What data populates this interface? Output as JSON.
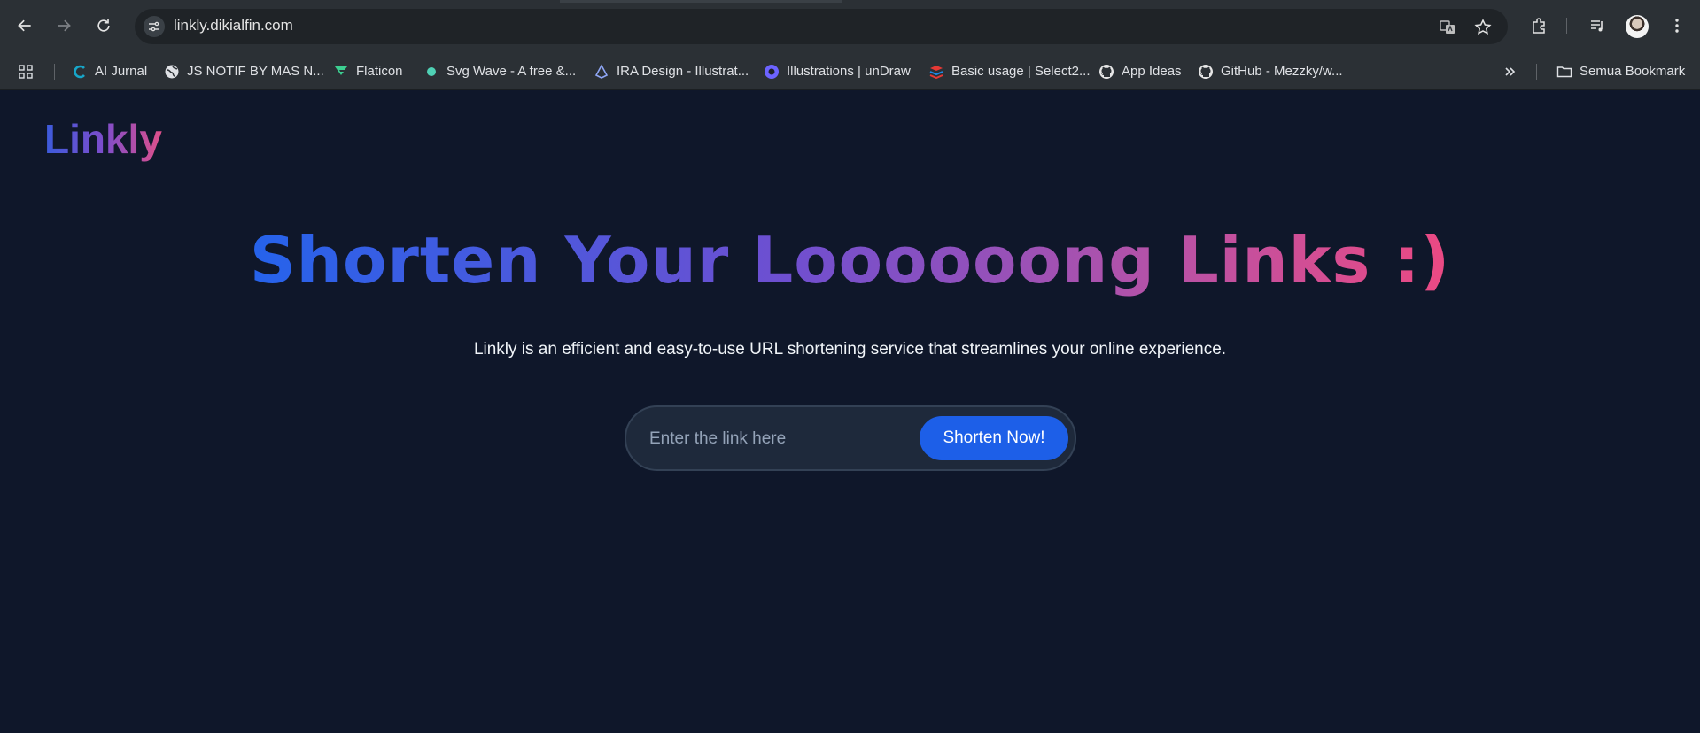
{
  "browser": {
    "url": "linkly.dikialfin.com",
    "bookmarks": [
      {
        "label": "AI Jurnal",
        "icon": "ai-jurnal-icon"
      },
      {
        "label": "JS NOTIF BY MAS N...",
        "icon": "globe-icon"
      },
      {
        "label": "Flaticon",
        "icon": "flaticon-icon"
      },
      {
        "label": "Svg Wave - A free &...",
        "icon": "svgwave-icon"
      },
      {
        "label": "IRA Design - Illustrat...",
        "icon": "ira-design-icon"
      },
      {
        "label": "Illustrations | unDraw",
        "icon": "undraw-icon"
      },
      {
        "label": "Basic usage | Select2...",
        "icon": "select2-icon"
      },
      {
        "label": "App Ideas",
        "icon": "github-icon"
      },
      {
        "label": "GitHub - Mezzky/w...",
        "icon": "github-icon"
      }
    ],
    "all_bookmarks_label": "Semua Bookmark"
  },
  "page": {
    "logo": "Linkly",
    "headline": "Shorten Your Loooooong Links :)",
    "subtitle": "Linkly is an efficient and easy-to-use URL shortening service that streamlines your online experience.",
    "input_placeholder": "Enter the link here",
    "input_value": "",
    "button_label": "Shorten Now!"
  },
  "colors": {
    "page_background": "#0f172a",
    "button": "#1d5fe8",
    "gradient_start": "#2563eb",
    "gradient_end": "#ec4a83"
  }
}
